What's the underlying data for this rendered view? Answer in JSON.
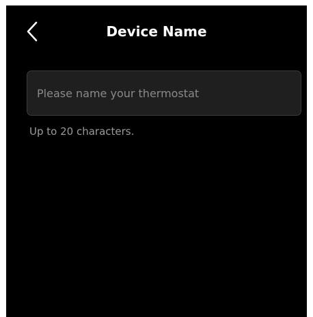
{
  "header": {
    "title": "Device Name",
    "back_icon": "chevron-left-icon"
  },
  "name_field": {
    "value": "",
    "placeholder": "Please name your thermostat"
  },
  "hint": "Up to 20 characters.",
  "colors": {
    "background": "#000000",
    "field_background": "#1f1f1f",
    "field_border": "#3c3c3c",
    "title_text": "#ffffff",
    "placeholder_text": "#8a8a8a",
    "hint_text": "#9a9a9a"
  }
}
